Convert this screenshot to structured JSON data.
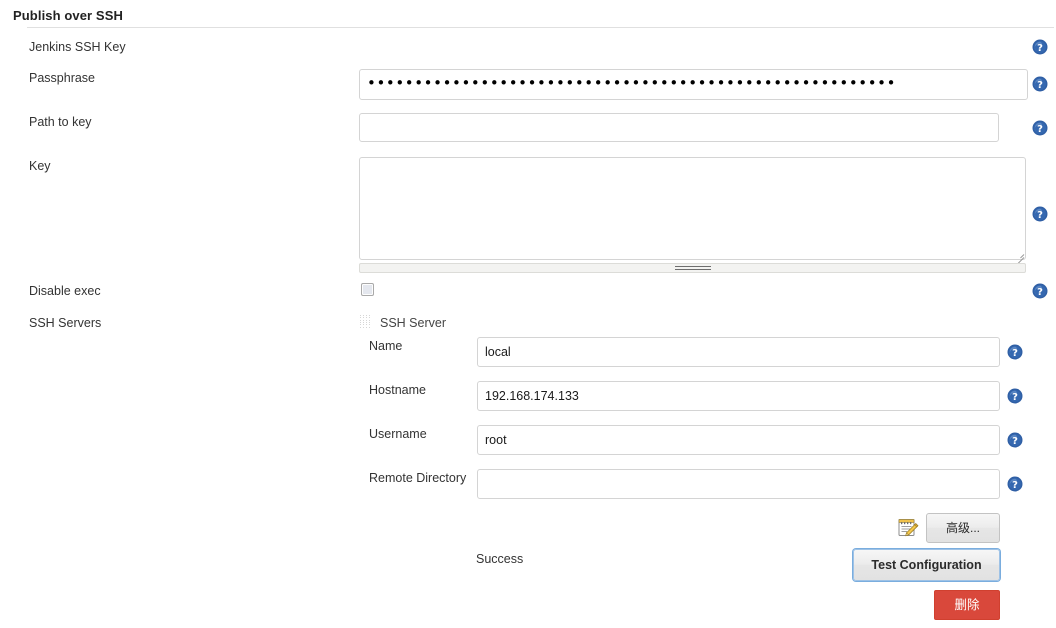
{
  "section": {
    "title": "Publish over SSH"
  },
  "fields": {
    "jenkins_ssh_key_label": "Jenkins SSH Key",
    "passphrase_label": "Passphrase",
    "passphrase_value": "••••••••••••••••••••••••••••••••••••••••••••••••••••••••",
    "path_to_key_label": "Path to key",
    "path_to_key_value": "",
    "path_to_key_placeholder": "",
    "key_label": "Key",
    "key_value": "",
    "key_placeholder": "",
    "disable_exec_label": "Disable exec",
    "disable_exec_checked": false,
    "ssh_servers_label": "SSH Servers"
  },
  "server": {
    "title": "SSH Server",
    "name_label": "Name",
    "name_value": "local",
    "hostname_label": "Hostname",
    "hostname_value": "192.168.174.133",
    "username_label": "Username",
    "username_value": "root",
    "remote_directory_label": "Remote Directory",
    "remote_directory_value": "",
    "remote_directory_placeholder": ""
  },
  "actions": {
    "advanced_label": "高级...",
    "advanced_icon": "notepad-pencil-icon",
    "test_configuration_label": "Test Configuration",
    "delete_label": "删除",
    "status_text": "Success"
  },
  "icons": {
    "help": "help-question-icon",
    "drag_handle": "drag-handle-icon"
  },
  "colors": {
    "help_blue": "#2f5fa5",
    "danger_red": "#d9483b",
    "focus_blue": "#7aadde",
    "border_gray": "#d4d4d4"
  }
}
